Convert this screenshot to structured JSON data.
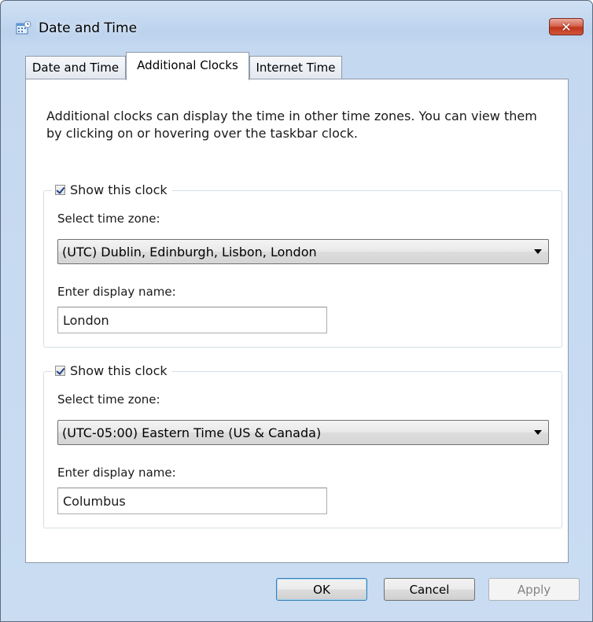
{
  "window": {
    "title": "Date and Time",
    "icon": "calendar-clock-icon",
    "close_glyph": "✕"
  },
  "tabs": [
    {
      "label": "Date and Time",
      "active": false
    },
    {
      "label": "Additional Clocks",
      "active": true
    },
    {
      "label": "Internet Time",
      "active": false
    }
  ],
  "description": "Additional clocks can display the time in other time zones. You can view them by clicking on or hovering over the taskbar clock.",
  "clocks": [
    {
      "show_label": "Show this clock",
      "checked": true,
      "timezone_label": "Select time zone:",
      "timezone_value": "(UTC) Dublin, Edinburgh, Lisbon, London",
      "name_label": "Enter display name:",
      "name_value": "London"
    },
    {
      "show_label": "Show this clock",
      "checked": true,
      "timezone_label": "Select time zone:",
      "timezone_value": "(UTC-05:00) Eastern Time (US & Canada)",
      "name_label": "Enter display name:",
      "name_value": "Columbus"
    }
  ],
  "buttons": {
    "ok": "OK",
    "cancel": "Cancel",
    "apply": "Apply"
  },
  "colors": {
    "accent": "#3c7fb1",
    "close": "#c2351b"
  }
}
